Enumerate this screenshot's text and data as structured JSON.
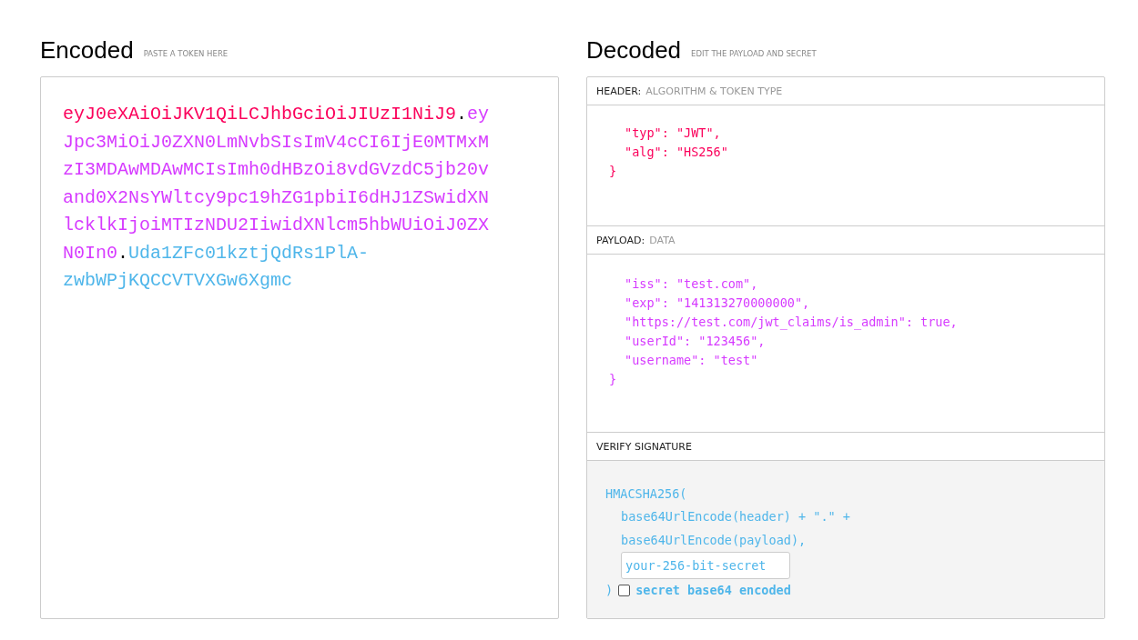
{
  "encoded": {
    "title": "Encoded",
    "subtitle": "PASTE A TOKEN HERE",
    "token": [
      {
        "text": "eyJ0eXAiOiJKV1QiLCJhbGciOiJIUzI1NiJ9",
        "color": "#fb015b"
      },
      {
        "text": ".",
        "color": "#000000"
      },
      {
        "text": "eyJpc3MiOiJ0ZXN0LmNvbSIsImV4cCI6IjE0MTMxMzI3MDAwMDAwMCIsImh0dHBzOi8vdGVzdC5jb20vand0X2NsYWltcy9pc19hZG1pbiI6dHJ1ZSwidXNlcklkIjoiMTIzNDU2IiwidXNlcm5hbWUiOiJ0ZXN0In0",
        "color": "#d63aff"
      },
      {
        "text": ".",
        "color": "#000000"
      },
      {
        "text": "Uda1ZFc01kztjQdRs1PlA-zwbWPjKQCCVTVXGw6Xgmc",
        "color": "#4fb6ea"
      }
    ]
  },
  "decoded": {
    "title": "Decoded",
    "subtitle": "EDIT THE PAYLOAD AND SECRET",
    "sections": [
      {
        "label": "HEADER:",
        "sublabel": "ALGORITHM & TOKEN TYPE",
        "color": "#fb015b",
        "lines": [
          {
            "kind": "entry",
            "text": "\"typ\": \"JWT\","
          },
          {
            "kind": "entry",
            "text": "\"alg\": \"HS256\""
          },
          {
            "kind": "close",
            "text": "}"
          }
        ]
      },
      {
        "label": "PAYLOAD:",
        "sublabel": "DATA",
        "color": "#d63aff",
        "lines": [
          {
            "kind": "entry",
            "text": "\"iss\": \"test.com\","
          },
          {
            "kind": "entry",
            "text": "\"exp\": \"141313270000000\","
          },
          {
            "kind": "entry",
            "text": "\"https://test.com/jwt_claims/is_admin\": true,"
          },
          {
            "kind": "entry",
            "text": "\"userId\": \"123456\","
          },
          {
            "kind": "entry",
            "text": "\"username\": \"test\""
          },
          {
            "kind": "close",
            "text": "}"
          }
        ]
      }
    ],
    "verify": {
      "label": "VERIFY SIGNATURE",
      "color": "#4fb6ea",
      "lines": [
        {
          "kind": "open",
          "text": "HMACSHA256("
        },
        {
          "kind": "arg",
          "text": "base64UrlEncode(header) + \".\" +"
        },
        {
          "kind": "arg",
          "text": "base64UrlEncode(payload),"
        }
      ],
      "secret": {
        "placeholder": "your-256-bit-secret"
      },
      "close": ")",
      "base64": {
        "label": "secret base64 encoded",
        "checked": false
      }
    }
  }
}
